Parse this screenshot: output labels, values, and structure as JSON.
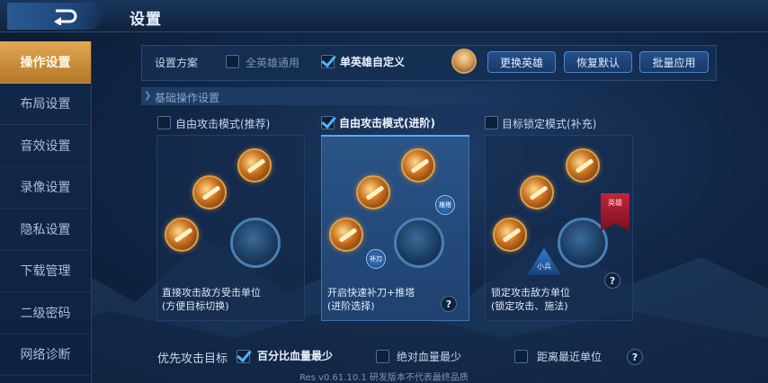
{
  "header": {
    "title": "设置"
  },
  "sidebar": {
    "items": [
      {
        "label": "操作设置",
        "active": true
      },
      {
        "label": "布局设置"
      },
      {
        "label": "音效设置"
      },
      {
        "label": "录像设置"
      },
      {
        "label": "隐私设置"
      },
      {
        "label": "下载管理"
      },
      {
        "label": "二级密码"
      },
      {
        "label": "网络诊断"
      }
    ]
  },
  "scheme": {
    "label": "设置方案",
    "option_all": "全英雄通用",
    "option_all_checked": false,
    "option_single": "单英雄自定义",
    "option_single_checked": true,
    "btn_change_hero": "更换英雄",
    "btn_restore_default": "恢复默认",
    "btn_batch_apply": "批量应用"
  },
  "section": {
    "title": "基础操作设置"
  },
  "modes": [
    {
      "title": "自由攻击模式(推荐)",
      "checked": false,
      "desc1": "直接攻击敌方受击单位",
      "desc2": "(方便目标切换)"
    },
    {
      "title": "自由攻击模式(进阶)",
      "checked": true,
      "desc1": "开启快速补刀+推塔",
      "desc2": "(进阶选择)",
      "icon_tower": "推塔",
      "icon_last_hit": "补刀"
    },
    {
      "title": "目标锁定模式(补充)",
      "checked": false,
      "desc1": "锁定攻击敌方单位",
      "desc2": "(锁定攻击、施法)",
      "tag_hero": "英雄",
      "tag_minion": "小兵"
    }
  ],
  "priority": {
    "label": "优先攻击目标",
    "options": [
      {
        "label": "百分比血量最少",
        "checked": true
      },
      {
        "label": "绝对血量最少",
        "checked": false
      },
      {
        "label": "距离最近单位",
        "checked": false
      }
    ]
  },
  "help_glyph": "?",
  "footer": {
    "version": "Res v0.61.10.1 研发版本不代表最终品质"
  },
  "colors": {
    "accent_gold": "#e0a954",
    "check_blue": "#4fb3ff",
    "panel_bg": "#163054"
  }
}
